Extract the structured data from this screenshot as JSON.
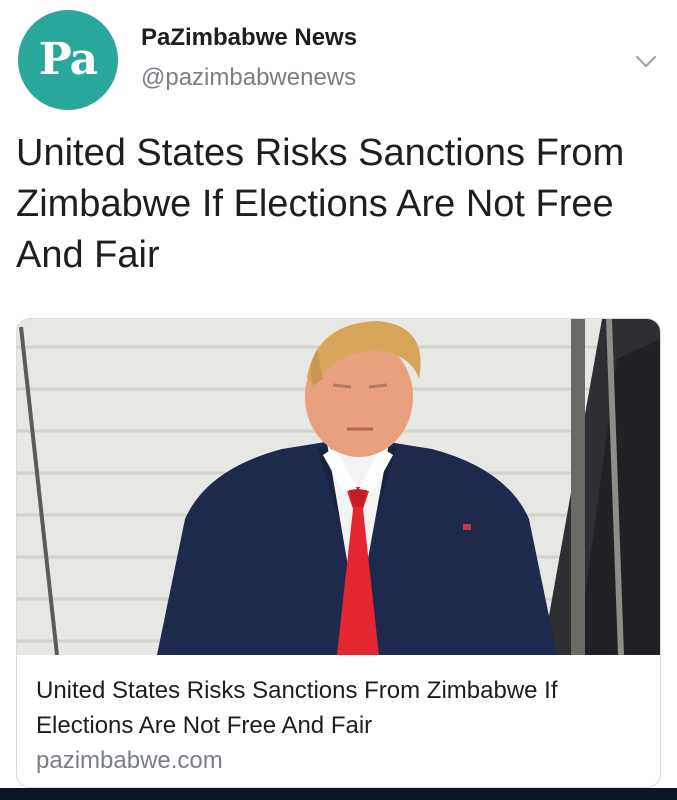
{
  "account": {
    "avatar_text": "Pa",
    "display_name": "PaZimbabwe News",
    "handle": "@pazimbabwenews"
  },
  "tweet": {
    "text": "United States Risks Sanctions From Zimbabwe If Elections Are Not Free And Fair"
  },
  "link_card": {
    "title": "United States Risks Sanctions From Zimbabwe If Elections Are Not Free And Fair",
    "domain": "pazimbabwe.com",
    "image_subject": "man in navy suit with red tie standing on steps"
  },
  "colors": {
    "avatar_bg": "#2aa79b",
    "secondary_text": "#7a7f86",
    "card_border": "#d7dbe0"
  },
  "icons": {
    "more": "chevron-down-icon"
  }
}
